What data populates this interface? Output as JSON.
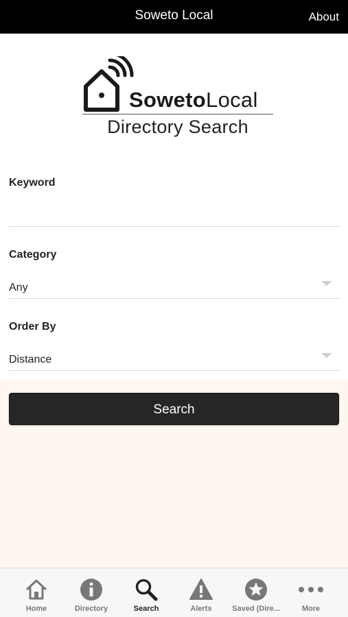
{
  "header": {
    "title": "Soweto Local",
    "about_label": "About"
  },
  "logo": {
    "brand_bold": "Soweto",
    "brand_light": "Local",
    "subtitle": "Directory Search"
  },
  "form": {
    "keyword": {
      "label": "Keyword",
      "value": "",
      "placeholder": ""
    },
    "category": {
      "label": "Category",
      "selected": "Any"
    },
    "order_by": {
      "label": "Order By",
      "selected": "Distance"
    },
    "search_label": "Search"
  },
  "tabs": [
    {
      "label": "Home",
      "icon": "home-icon",
      "active": false
    },
    {
      "label": "Directory",
      "icon": "info-icon",
      "active": false
    },
    {
      "label": "Search",
      "icon": "search-icon",
      "active": true
    },
    {
      "label": "Alerts",
      "icon": "warning-icon",
      "active": false
    },
    {
      "label": "Saved (Dire...",
      "icon": "star-icon",
      "active": false
    },
    {
      "label": "More",
      "icon": "more-icon",
      "active": false
    }
  ],
  "colors": {
    "header_bg": "#000000",
    "button_bg": "#262626",
    "page_bg": "#fdf7f0",
    "icon_gray": "#777777",
    "icon_active": "#222222"
  }
}
